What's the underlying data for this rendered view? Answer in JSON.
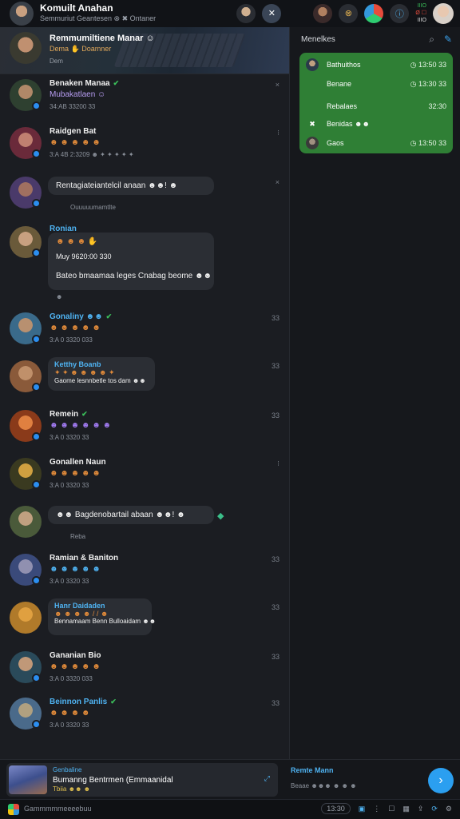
{
  "topbar": {
    "title": "Komuilt Anahan",
    "subtitle": "Semmuriut Geantesen ⊗ ✖ Ontaner",
    "status_top": "IIIO",
    "status_mid": "Ø ☐",
    "status_bottom": "IIIO",
    "accent": "#2b9ff0"
  },
  "hero": {
    "title": "Remmumiltiene Manar ☺",
    "subtitle": "Dema ✋ Doamner",
    "meta": "Dem"
  },
  "feed": [
    {
      "name": "Benaken Manaa",
      "verified": true,
      "line2": "Mubakatlaen ☺",
      "meta": "34:AB 33200 33",
      "side": "×",
      "avatar_color": "#3a5a3a"
    },
    {
      "name": "Raidgen Bat",
      "verified": false,
      "line2": "☻ ☻ ☻ ☻ ☻",
      "meta": "3:A 4B 2:3209 ☻ ✦ ✦ ✦ ✦ ✦",
      "side": "⁝",
      "avatar_color": "#7a2a3a"
    },
    {
      "name": "",
      "bubble": "Rentagiateiantelcil anaan ☻☻! ☻",
      "meta": "Ouuuuumamtlte",
      "side": "×",
      "avatar_color": "#4a3a6a"
    },
    {
      "name": "Ronian",
      "bubble_lines": [
        "☻ ☻ ☻ ✋",
        "Muy 9620:00 330",
        "Bateo bmaamaa leges Cnabag beome ☻☻"
      ],
      "meta": "☻",
      "side": "",
      "avatar_color": "#6a5a3a"
    },
    {
      "name": "Gonaliny ☻☻",
      "verified": true,
      "line2": "☻ ☻ ☻ ☻ ☻",
      "meta": "3:A 0 3320 033",
      "side": "33",
      "avatar_color": "#3a6a8a"
    },
    {
      "name": "Ketthy Boanb",
      "bubble_lines": [
        "✦ ✦ ☻ ☻ ☻ ☻ ✦",
        "Gaome lesnnbetle tos dam ☻☻"
      ],
      "meta": "",
      "side": "33",
      "avatar_color": "#8a5a3a"
    },
    {
      "name": "Remein",
      "verified": true,
      "line2": "☻ ☻ ☻ ☻ ☻ ☻",
      "meta": "3:A 0 3320 33",
      "side": "33",
      "avatar_color": "#8a3a1a"
    },
    {
      "name": "Gonallen Naun",
      "verified": false,
      "line2": "☻ ☻ ☻ ☻ ☻",
      "meta": "3:A 0 3320 33",
      "side": "⁝",
      "avatar_color": "#6a6a2a"
    },
    {
      "name": "",
      "bubble": "☻☻ Bagdenobartail abaan ☻☻! ☻",
      "meta": "Reba",
      "side": "",
      "avatar_color": "#4a5a3a"
    },
    {
      "name": "Ramian & Baniton",
      "verified": false,
      "line2": "☻ ☻ ☻ ☻ ☻",
      "meta": "3:A 0 3320 33",
      "side": "33",
      "avatar_color": "#3a4a7a"
    },
    {
      "name": "Hanr Daidaden",
      "bubble_lines": [
        "☻ ☻ ☻ ☻ / / ☻",
        "Bennamaam Benn Bulloaidam ☻☻"
      ],
      "meta": "",
      "side": "33",
      "avatar_color": "#b07a2a"
    },
    {
      "name": "Gananian Bio",
      "verified": false,
      "line2": "☻ ☻ ☻ ☻ ☻",
      "meta": "3:A 0 3320 033",
      "side": "33",
      "avatar_color": "#2a4a5a"
    },
    {
      "name": "Beinnon Panlis",
      "verified": true,
      "line2": "☻ ☻ ☻ ☻",
      "meta": "3:A 0 3320 33",
      "side": "33",
      "avatar_color": "#4a6a8a"
    }
  ],
  "right_panel": {
    "header": "Menelkes",
    "rows": [
      {
        "label": "Bathuithos",
        "time": "13:50 33"
      },
      {
        "label": "Benane",
        "time": "13:30 33"
      },
      {
        "label": "Rebalaes",
        "time": "32:30"
      },
      {
        "label": "Benidas ☻☻",
        "time": ""
      },
      {
        "label": "Gaos",
        "time": "13:50 33"
      }
    ]
  },
  "composer": {
    "label": "Genbaline",
    "text": "Bumanng Bentrmen (Emmaanidal",
    "tag": "Tbiia ☻☻ ☻",
    "right_title": "Remte Mann",
    "right_sub": "Beaae ☻☻☻ ☻ ☻ ☻"
  },
  "statusbar": {
    "text": "Gammmmmeeeebuu",
    "pill": "13:30"
  }
}
